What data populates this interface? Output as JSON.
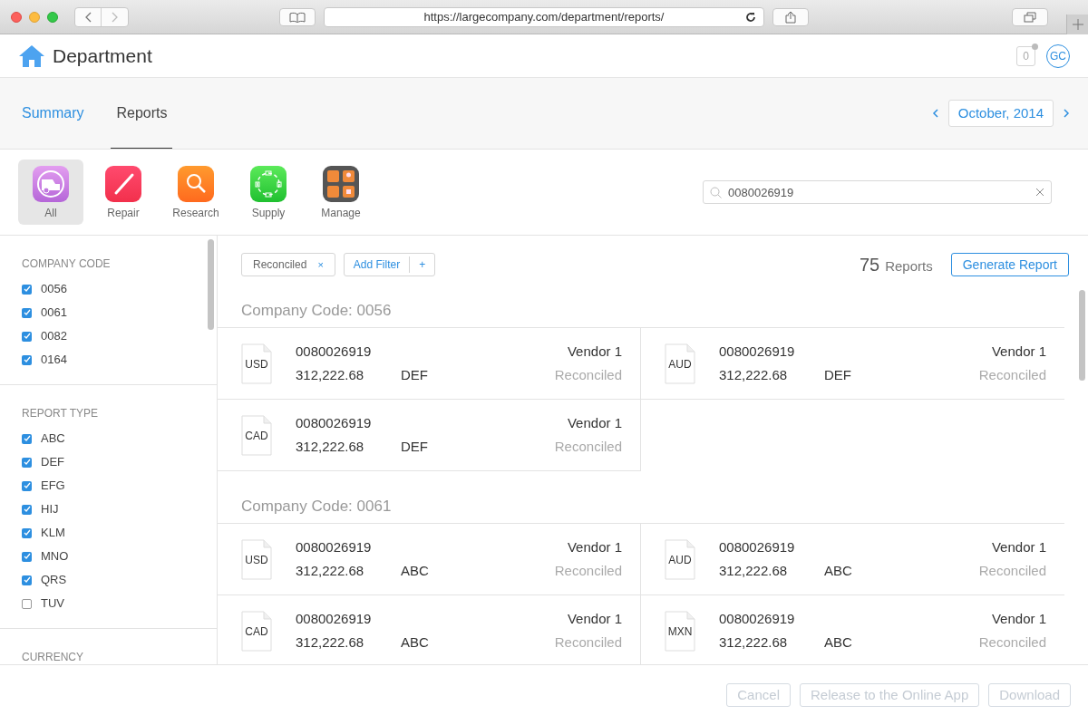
{
  "browser": {
    "url": "https://largecompany.com/department/reports/"
  },
  "header": {
    "title": "Department",
    "notification_count": "0",
    "avatar_initials": "GC"
  },
  "tabs": [
    {
      "label": "Summary",
      "selected": false
    },
    {
      "label": "Reports",
      "selected": true
    }
  ],
  "date_picker": {
    "label": "October, 2014"
  },
  "categories": [
    {
      "label": "All",
      "kind": "all",
      "selected": true
    },
    {
      "label": "Repair",
      "kind": "repair",
      "selected": false
    },
    {
      "label": "Research",
      "kind": "research",
      "selected": false
    },
    {
      "label": "Supply",
      "kind": "supply",
      "selected": false
    },
    {
      "label": "Manage",
      "kind": "manage",
      "selected": false
    }
  ],
  "search": {
    "value": "0080026919"
  },
  "sidebar": {
    "sections": [
      {
        "title": "COMPANY CODE",
        "items": [
          {
            "label": "0056",
            "checked": true
          },
          {
            "label": "0061",
            "checked": true
          },
          {
            "label": "0082",
            "checked": true
          },
          {
            "label": "0164",
            "checked": true
          }
        ]
      },
      {
        "title": "REPORT TYPE",
        "items": [
          {
            "label": "ABC",
            "checked": true
          },
          {
            "label": "DEF",
            "checked": true
          },
          {
            "label": "EFG",
            "checked": true
          },
          {
            "label": "HIJ",
            "checked": true
          },
          {
            "label": "KLM",
            "checked": true
          },
          {
            "label": "MNO",
            "checked": true
          },
          {
            "label": "QRS",
            "checked": true
          },
          {
            "label": "TUV",
            "checked": false
          }
        ]
      },
      {
        "title": "CURRENCY"
      }
    ]
  },
  "filters": {
    "active": [
      {
        "label": "Reconciled",
        "remove": "×"
      }
    ],
    "add_label": "Add Filter",
    "add_symbol": "+"
  },
  "report_count": {
    "number": "75",
    "label": "Reports"
  },
  "generate_button": "Generate Report",
  "groups": [
    {
      "title": "Company Code: 0056",
      "reports": [
        {
          "currency": "USD",
          "number": "0080026919",
          "amount": "312,222.68",
          "type": "DEF",
          "vendor": "Vendor 1",
          "status": "Reconciled"
        },
        {
          "currency": "AUD",
          "number": "0080026919",
          "amount": "312,222.68",
          "type": "DEF",
          "vendor": "Vendor 1",
          "status": "Reconciled"
        },
        {
          "currency": "CAD",
          "number": "0080026919",
          "amount": "312,222.68",
          "type": "DEF",
          "vendor": "Vendor 1",
          "status": "Reconciled"
        }
      ]
    },
    {
      "title": "Company Code: 0061",
      "reports": [
        {
          "currency": "USD",
          "number": "0080026919",
          "amount": "312,222.68",
          "type": "ABC",
          "vendor": "Vendor 1",
          "status": "Reconciled"
        },
        {
          "currency": "AUD",
          "number": "0080026919",
          "amount": "312,222.68",
          "type": "ABC",
          "vendor": "Vendor 1",
          "status": "Reconciled"
        },
        {
          "currency": "CAD",
          "number": "0080026919",
          "amount": "312,222.68",
          "type": "ABC",
          "vendor": "Vendor 1",
          "status": "Reconciled"
        },
        {
          "currency": "MXN",
          "number": "0080026919",
          "amount": "312,222.68",
          "type": "ABC",
          "vendor": "Vendor 1",
          "status": "Reconciled"
        }
      ]
    }
  ],
  "footer_buttons": [
    {
      "label": "Cancel",
      "disabled": true
    },
    {
      "label": "Release to the Online App",
      "disabled": true
    },
    {
      "label": "Download",
      "disabled": true
    }
  ]
}
